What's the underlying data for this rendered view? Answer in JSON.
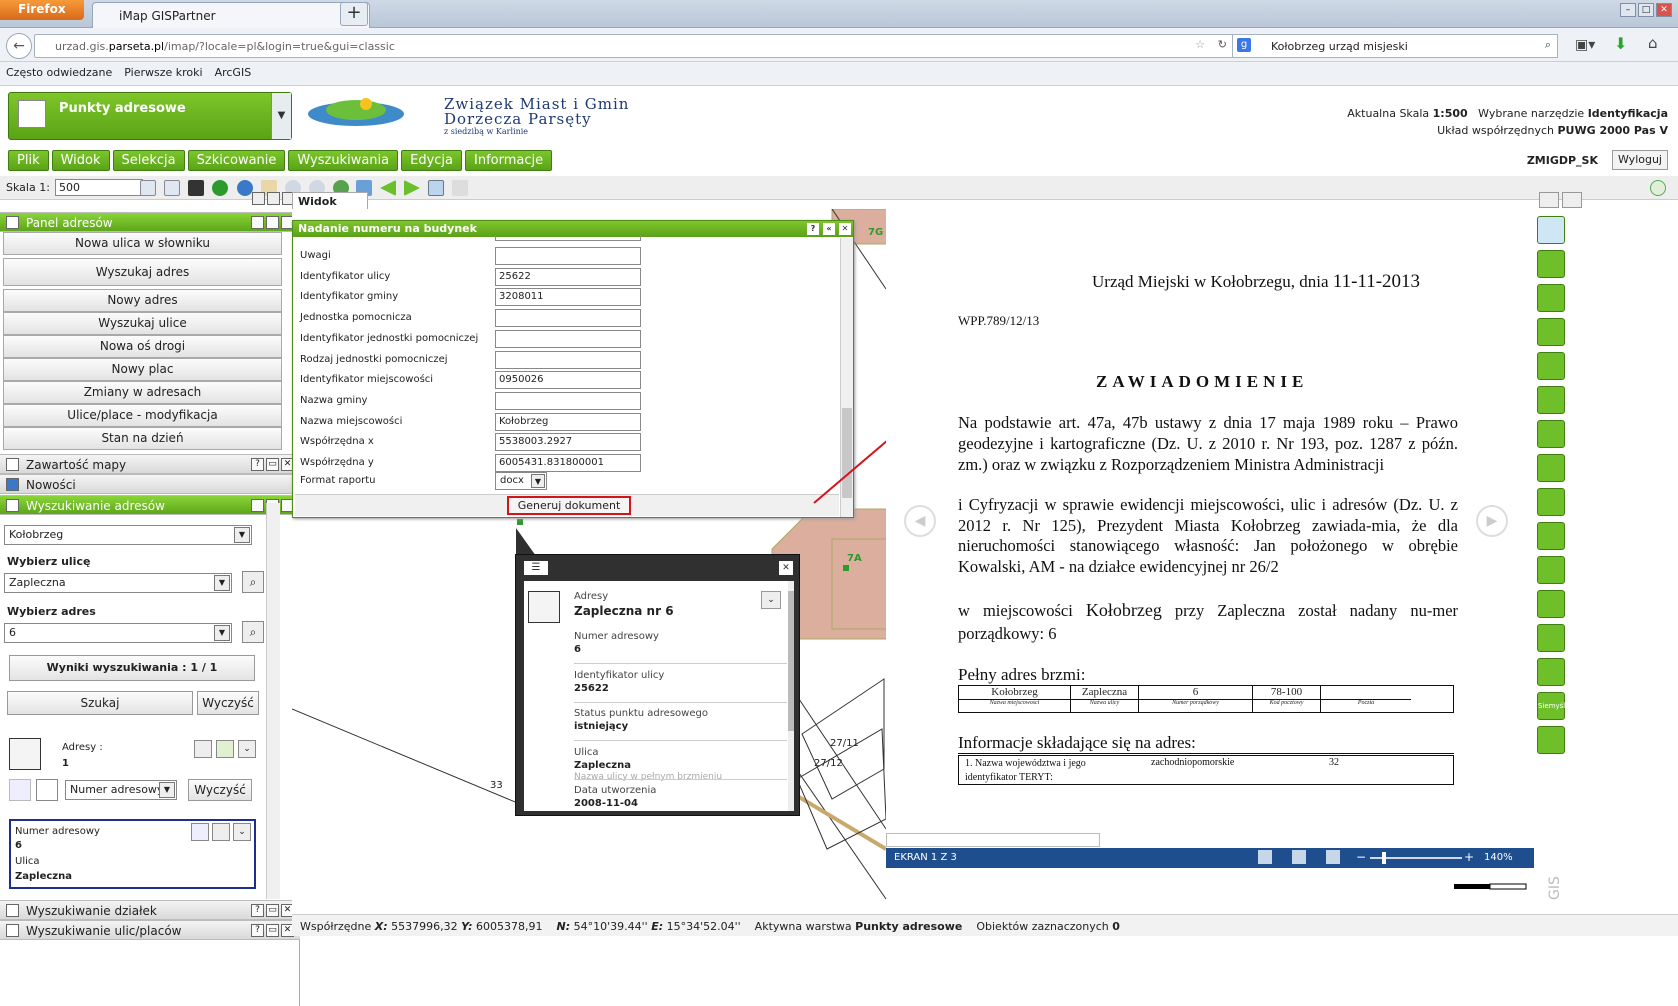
{
  "browser": {
    "menu_label": "Firefox",
    "tab_title": "iMap GISPartner",
    "url_prefix": "urzad.gis.",
    "url_domain": "parseta.pl",
    "url_rest": "/imap/?locale=pl&login=true&gui=classic",
    "search_query": "Kołobrzeg urząd misjeski",
    "bookmarks": [
      "Często odwiedzane",
      "Pierwsze kroki",
      "ArcGIS"
    ]
  },
  "app": {
    "active_layer": "Punkty adresowe",
    "org_line1": "Związek Miast i Gmin",
    "org_line2": "Dorzecza Parsęty",
    "org_line3": "z siedzibą w Karlinie",
    "scale_label": "Aktualna Skala",
    "scale_value": "1:500",
    "tool_label": "Wybrane narzędzie",
    "tool_value": "Identyfikacja",
    "crs_label": "Układ współrzędnych",
    "crs_value": "PUWG 2000 Pas V",
    "menu": [
      "Plik",
      "Widok",
      "Selekcja",
      "Szkicowanie",
      "Wyszukiwania",
      "Edycja",
      "Informacje"
    ],
    "user": "ZMIGDP_SK",
    "logout": "Wyloguj",
    "skala_label": "Skala 1:",
    "skala_value": "500"
  },
  "left": {
    "panel_addresses": "Panel adresów",
    "buttons": [
      "Nowa ulica w słowniku",
      "Wyszukaj adres",
      "Nowy adres",
      "Wyszukaj ulice",
      "Nowa oś drogi",
      "Nowy plac",
      "Zmiany w adresach",
      "Ulice/place - modyfikacja",
      "Stan na dzień"
    ],
    "panel_map_content": "Zawartość mapy",
    "panel_news": "Nowości",
    "panel_search": "Wyszukiwanie adresów",
    "city_value": "Kołobrzeg",
    "street_label": "Wybierz ulicę",
    "street_value": "Zapleczna",
    "address_label": "Wybierz adres",
    "address_value": "6",
    "results": "Wyniki wyszukiwania : 1 / 1",
    "search_btn": "Szukaj",
    "clear_btn": "Wyczyść",
    "result_label": "Adresy :",
    "result_count": "1",
    "sort_value": "Numer adresowy",
    "clear_btn2": "Wyczyść",
    "card_num_label": "Numer adresowy",
    "card_num_value": "6",
    "card_street_label": "Ulica",
    "card_street_value": "Zapleczna",
    "panel_parcels": "Wyszukiwanie działek",
    "panel_streets": "Wyszukiwanie ulic/placów"
  },
  "map": {
    "tab": "Widok mapy",
    "labels": [
      "7G",
      "7A",
      "27/11",
      "27/12",
      "33",
      "6"
    ]
  },
  "dialog": {
    "title": "Nadanie numeru na budynek",
    "fields": [
      {
        "label": "Uwagi",
        "value": ""
      },
      {
        "label": "Identyfikator ulicy",
        "value": "25622"
      },
      {
        "label": "Identyfikator gminy",
        "value": "3208011"
      },
      {
        "label": "Jednostka pomocnicza",
        "value": ""
      },
      {
        "label": "Identyfikator jednostki pomocniczej",
        "value": ""
      },
      {
        "label": "Rodzaj jednostki pomocniczej",
        "value": ""
      },
      {
        "label": "Identyfikator miejscowości",
        "value": "0950026"
      },
      {
        "label": "Nazwa gminy",
        "value": ""
      },
      {
        "label": "Nazwa miejscowości",
        "value": "Kołobrzeg"
      },
      {
        "label": "Współrzędna x",
        "value": "5538003.2927"
      },
      {
        "label": "Współrzędna y",
        "value": "6005431.831800001"
      }
    ],
    "format_label": "Format raportu",
    "format_value": "docx",
    "generate": "Generuj dokument"
  },
  "popup": {
    "category": "Adresy",
    "title": "Zapleczna nr 6",
    "rows": [
      {
        "label": "Numer adresowy",
        "value": "6",
        "note": ""
      },
      {
        "label": "Identyfikator ulicy",
        "value": "25622",
        "note": ""
      },
      {
        "label": "Status punktu adresowego",
        "value": "istniejący",
        "note": ""
      },
      {
        "label": "Ulica",
        "value": "Zapleczna",
        "note": "Nazwa ulicy w pełnym brzmieniu"
      },
      {
        "label": "Data utworzenia",
        "value": "2008-11-04",
        "note": ""
      }
    ]
  },
  "document": {
    "header_text": "Urząd Miejski w Kołobrzegu, dnia",
    "header_date": "11-11-2013",
    "ref": "WPP.789/12/13",
    "heading": "ZAWIADOMIENIE",
    "para1": "Na podstawie art. 47a, 47b ustawy z dnia 17 maja 1989 roku – Prawo geodezyjne i kartograficzne (Dz. U.  z 2010 r. Nr 193, poz. 1287 z późn. zm.) oraz w związku z Rozporządzeniem Ministra Administracji",
    "para2": "i Cyfryzacji w sprawie ewidencji miejscowości, ulic i adresów (Dz. U. z 2012 r. Nr 125), Prezydent Miasta Kołobrzeg zawiada-mia, że dla nieruchomości stanowiącego własność: Jan położonego w obrębie Kowalski, AM -  na działce ewidencyjnej nr 26/2",
    "para3a": "w miejscowości",
    "para3city": "Kołobrzeg",
    "para3b": "przy Zapleczna został  nadany  nu-mer  porządkowy: 6",
    "full_address_label": "Pełny adres brzmi:",
    "addr_values": [
      "Kołobrzeg",
      "Zapleczna",
      "6",
      "78-100",
      ""
    ],
    "addr_headers": [
      "Nazwa miejscowości",
      "Nazwa ulicy",
      "Numer porządkowy",
      "Kod pocztowy",
      "Poczta"
    ],
    "info_label": "Informacje składające się na adres:",
    "info_row_label": "1. Nazwa województwa i jego identyfikator TERYT:",
    "info_row_value": "zachodniopomorskie",
    "info_row_code": "32"
  },
  "viewer": {
    "page_label": "EKRAN 1 Z 3",
    "zoom": "140%"
  },
  "rail": {
    "tile_label": "Siemyśl"
  },
  "status": {
    "coords_label": "Współrzędne",
    "x_label": "X:",
    "x_value": "5537996,32",
    "y_label": "Y:",
    "y_value": "6005378,91",
    "n_label": "N:",
    "n_value": "54°10'39.44''",
    "e_label": "E:",
    "e_value": "15°34'52.04''",
    "layer_label": "Aktywna warstwa",
    "layer_value": "Punkty adresowe",
    "selected_label": "Obiektów zaznaczonych",
    "selected_value": "0"
  },
  "colors": {
    "accent_green": "#5aa318",
    "popup_dark": "#303030",
    "highlight_red": "#d4141b",
    "viewer_blue": "#1e4e8e",
    "parcel_fill": "#dcae9e"
  }
}
